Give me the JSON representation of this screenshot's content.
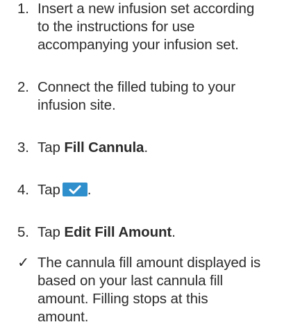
{
  "instructions": [
    {
      "marker": "1.",
      "lines": [
        "Insert a new infusion set according",
        "to the instructions for use",
        "accompanying your infusion set."
      ]
    },
    {
      "marker": "2.",
      "lines": [
        "Connect the filled tubing to your",
        "infusion site."
      ]
    },
    {
      "marker": "3.",
      "prefix": "Tap",
      "bold": "Fill Cannula",
      "suffix": "."
    },
    {
      "marker": "4.",
      "prefix": "Tap",
      "icon": "checkmark-icon",
      "suffix": "."
    },
    {
      "marker": "5.",
      "prefix": "Tap",
      "bold": "Edit Fill Amount",
      "suffix": "."
    },
    {
      "marker": "✓",
      "lines": [
        "The cannula fill amount displayed is",
        "based on your last cannula fill",
        "amount. Filling stops at this",
        "amount."
      ]
    }
  ],
  "colors": {
    "button_fill": "#2f8fcc",
    "text": "#2b2b2b"
  }
}
